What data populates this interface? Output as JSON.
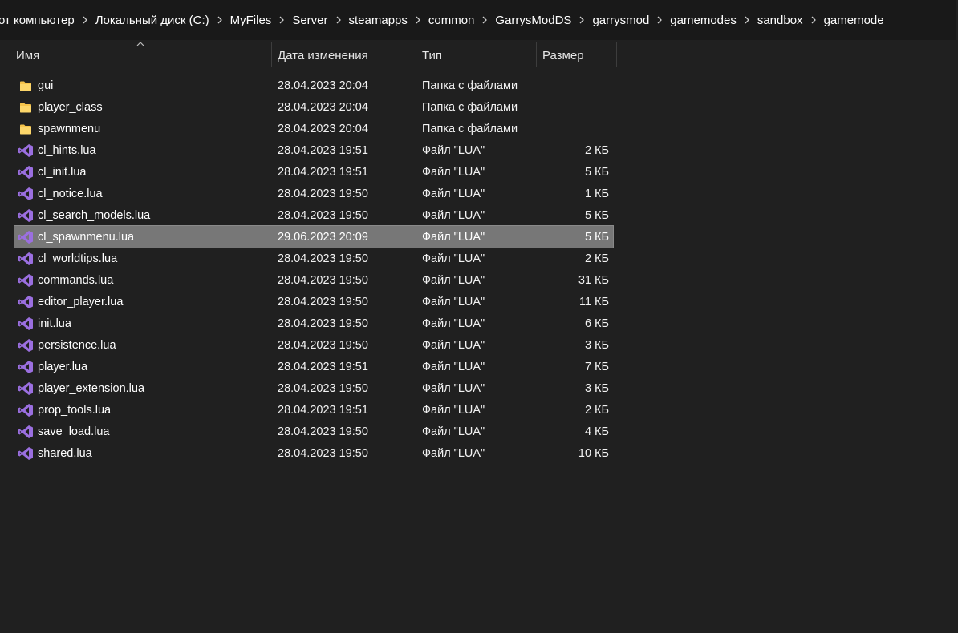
{
  "breadcrumb": [
    "от компьютер",
    "Локальный диск (C:)",
    "MyFiles",
    "Server",
    "steamapps",
    "common",
    "GarrysModDS",
    "garrysmod",
    "gamemodes",
    "sandbox",
    "gamemode"
  ],
  "columns": {
    "name": "Имя",
    "date": "Дата изменения",
    "type": "Тип",
    "size": "Размер"
  },
  "colors": {
    "folder": "#f5c34b",
    "lua_icon": "#9b6fe0",
    "selected_row": "#777777",
    "background": "#202020"
  },
  "files": [
    {
      "icon": "folder-icon",
      "name": "gui",
      "date": "28.04.2023 20:04",
      "type": "Папка с файлами",
      "size": "",
      "selected": false
    },
    {
      "icon": "folder-icon",
      "name": "player_class",
      "date": "28.04.2023 20:04",
      "type": "Папка с файлами",
      "size": "",
      "selected": false
    },
    {
      "icon": "folder-icon",
      "name": "spawnmenu",
      "date": "28.04.2023 20:04",
      "type": "Папка с файлами",
      "size": "",
      "selected": false
    },
    {
      "icon": "lua-file-icon",
      "name": "cl_hints.lua",
      "date": "28.04.2023 19:51",
      "type": "Файл \"LUA\"",
      "size": "2 КБ",
      "selected": false
    },
    {
      "icon": "lua-file-icon",
      "name": "cl_init.lua",
      "date": "28.04.2023 19:51",
      "type": "Файл \"LUA\"",
      "size": "5 КБ",
      "selected": false
    },
    {
      "icon": "lua-file-icon",
      "name": "cl_notice.lua",
      "date": "28.04.2023 19:50",
      "type": "Файл \"LUA\"",
      "size": "1 КБ",
      "selected": false
    },
    {
      "icon": "lua-file-icon",
      "name": "cl_search_models.lua",
      "date": "28.04.2023 19:50",
      "type": "Файл \"LUA\"",
      "size": "5 КБ",
      "selected": false
    },
    {
      "icon": "lua-file-icon",
      "name": "cl_spawnmenu.lua",
      "date": "29.06.2023 20:09",
      "type": "Файл \"LUA\"",
      "size": "5 КБ",
      "selected": true
    },
    {
      "icon": "lua-file-icon",
      "name": "cl_worldtips.lua",
      "date": "28.04.2023 19:50",
      "type": "Файл \"LUA\"",
      "size": "2 КБ",
      "selected": false
    },
    {
      "icon": "lua-file-icon",
      "name": "commands.lua",
      "date": "28.04.2023 19:50",
      "type": "Файл \"LUA\"",
      "size": "31 КБ",
      "selected": false
    },
    {
      "icon": "lua-file-icon",
      "name": "editor_player.lua",
      "date": "28.04.2023 19:50",
      "type": "Файл \"LUA\"",
      "size": "11 КБ",
      "selected": false
    },
    {
      "icon": "lua-file-icon",
      "name": "init.lua",
      "date": "28.04.2023 19:50",
      "type": "Файл \"LUA\"",
      "size": "6 КБ",
      "selected": false
    },
    {
      "icon": "lua-file-icon",
      "name": "persistence.lua",
      "date": "28.04.2023 19:50",
      "type": "Файл \"LUA\"",
      "size": "3 КБ",
      "selected": false
    },
    {
      "icon": "lua-file-icon",
      "name": "player.lua",
      "date": "28.04.2023 19:51",
      "type": "Файл \"LUA\"",
      "size": "7 КБ",
      "selected": false
    },
    {
      "icon": "lua-file-icon",
      "name": "player_extension.lua",
      "date": "28.04.2023 19:50",
      "type": "Файл \"LUA\"",
      "size": "3 КБ",
      "selected": false
    },
    {
      "icon": "lua-file-icon",
      "name": "prop_tools.lua",
      "date": "28.04.2023 19:51",
      "type": "Файл \"LUA\"",
      "size": "2 КБ",
      "selected": false
    },
    {
      "icon": "lua-file-icon",
      "name": "save_load.lua",
      "date": "28.04.2023 19:50",
      "type": "Файл \"LUA\"",
      "size": "4 КБ",
      "selected": false
    },
    {
      "icon": "lua-file-icon",
      "name": "shared.lua",
      "date": "28.04.2023 19:50",
      "type": "Файл \"LUA\"",
      "size": "10 КБ",
      "selected": false
    }
  ]
}
